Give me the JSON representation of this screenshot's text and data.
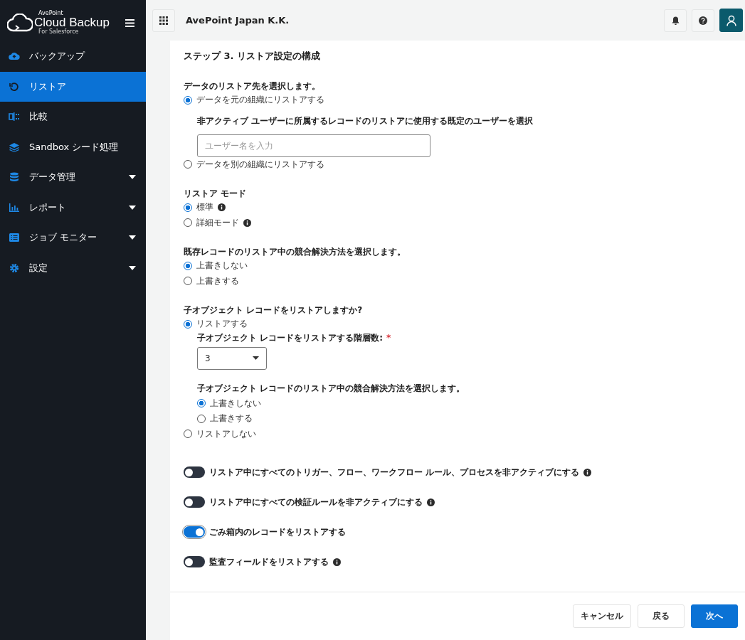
{
  "sidebar": {
    "logo": {
      "brand": "AvePoint",
      "product": "Cloud Backup",
      "edition": "For Salesforce"
    },
    "items": [
      {
        "kind": "cloud",
        "label": "バックアップ",
        "selected": false,
        "expandable": false
      },
      {
        "kind": "restore",
        "label": "リストア",
        "selected": true,
        "expandable": false
      },
      {
        "kind": "compare",
        "label": "比較",
        "selected": false,
        "expandable": false
      },
      {
        "kind": "layers",
        "label": "Sandbox シード処理",
        "selected": false,
        "expandable": false
      },
      {
        "kind": "database",
        "label": "データ管理",
        "selected": false,
        "expandable": true
      },
      {
        "kind": "chart",
        "label": "レポート",
        "selected": false,
        "expandable": true
      },
      {
        "kind": "list",
        "label": "ジョブ モニター",
        "selected": false,
        "expandable": true
      },
      {
        "kind": "gear",
        "label": "設定",
        "selected": false,
        "expandable": true
      }
    ]
  },
  "header": {
    "organization": "AvePoint Japan K.K."
  },
  "page": {
    "title": "ステップ 3. リストア設定の構成",
    "sections": [
      {
        "label": "データのリストア先を選択します。",
        "options": [
          {
            "label": "データを元の組織にリストアする",
            "selected": true,
            "info": false,
            "sub": [
              {
                "kind": "text-field",
                "label": "非アクティブ ユーザーに所属するレコードのリストアに使用する既定のユーザーを選択",
                "placeholder": "ユーザー名を入力"
              }
            ]
          },
          {
            "label": "データを別の組織にリストアする",
            "selected": false,
            "info": false
          }
        ]
      },
      {
        "label": "リストア モード",
        "options": [
          {
            "label": "標準",
            "selected": true,
            "info": true
          },
          {
            "label": "詳細モード",
            "selected": false,
            "info": true
          }
        ]
      },
      {
        "label": "既存レコードのリストア中の競合解決方法を選択します。",
        "options": [
          {
            "label": "上書きしない",
            "selected": true,
            "info": false
          },
          {
            "label": "上書きする",
            "selected": false,
            "info": false
          }
        ]
      },
      {
        "label": "子オブジェクト レコードをリストアしますか?",
        "options": [
          {
            "label": "リストアする",
            "selected": true,
            "info": false,
            "sub": [
              {
                "kind": "select",
                "label": "子オブジェクト レコードをリストアする階層数:",
                "required_mark": "*",
                "value": "3"
              },
              {
                "kind": "radio-group",
                "label": "子オブジェクト レコードのリストア中の競合解決方法を選択します。",
                "options": [
                  {
                    "label": "上書きしない",
                    "selected": true,
                    "info": false
                  },
                  {
                    "label": "上書きする",
                    "selected": false,
                    "info": false
                  }
                ]
              }
            ]
          },
          {
            "label": "リストアしない",
            "selected": false,
            "info": false
          }
        ]
      }
    ],
    "toggles": [
      {
        "label": "リストア中にすべてのトリガー、フロー、ワークフロー ルール、プロセスを非アクティブにする",
        "on": false,
        "info": true
      },
      {
        "label": "リストア中にすべての検証ルールを非アクティブにする",
        "on": false,
        "info": true
      },
      {
        "label": "ごみ箱内のレコードをリストアする",
        "on": true,
        "info": false
      },
      {
        "label": "監査フィールドをリストアする",
        "on": false,
        "info": true
      }
    ],
    "buttons": [
      {
        "kind": "secondary",
        "label": "キャンセル"
      },
      {
        "kind": "secondary",
        "label": "戻る"
      },
      {
        "kind": "primary",
        "label": "次へ"
      }
    ]
  }
}
